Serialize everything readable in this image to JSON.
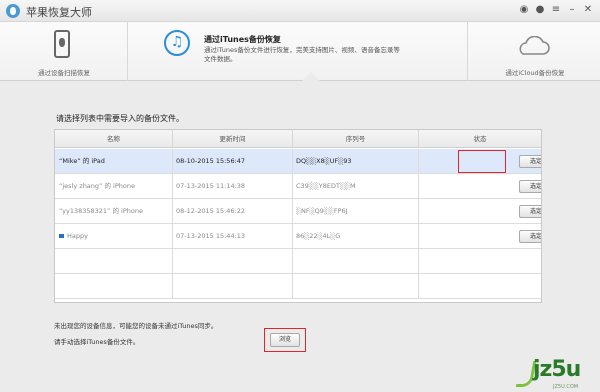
{
  "app_title": "苹果恢复大师",
  "nav": {
    "left_label": "通过设备扫描恢复",
    "mid_title": "通过iTunes备份恢复",
    "mid_desc": "通过iTunes备份文件进行恢复，完美支持图片、视频、语音备忘录等文件数据。",
    "right_label": "通过iCloud备份恢复"
  },
  "prompt": "请选择列表中需要导入的备份文件。",
  "table": {
    "headers": [
      "名称",
      "更新时间",
      "序列号",
      "状态"
    ],
    "rows": [
      {
        "name": "“Mike” 的 iPad",
        "time": "08-10-2015 15:56:47",
        "serial": "DQ░░X8░UF░93",
        "action": "选定",
        "selected": true,
        "locked": false
      },
      {
        "name": "“jesly zhang” 的 iPhone",
        "time": "07-13-2015 11:14:38",
        "serial": "C39░░Y8EDT░░M",
        "action": "选定",
        "selected": false,
        "locked": false
      },
      {
        "name": "“yy138358321” 的 iPhone",
        "time": "08-12-2015 15:46:22",
        "serial": "░NF░Q9░░FP6J",
        "action": "选定",
        "selected": false,
        "locked": false
      },
      {
        "name": "Happy",
        "time": "07-13-2015 15:44:13",
        "serial": "86░22░4L░G",
        "action": "选定",
        "selected": false,
        "locked": true
      }
    ]
  },
  "note1": "未出现您的设备信息，可能您的设备未通过iTunes同步。",
  "note2": "请手动选择iTunes备份文件。",
  "browse_label": "浏览",
  "watermark": {
    "main": "jz5u",
    "sub": "JZ5U.COM"
  },
  "colors": {
    "accent": "#2a8fd8",
    "highlight": "#e0262b",
    "selected_row": "#dde9fb"
  }
}
